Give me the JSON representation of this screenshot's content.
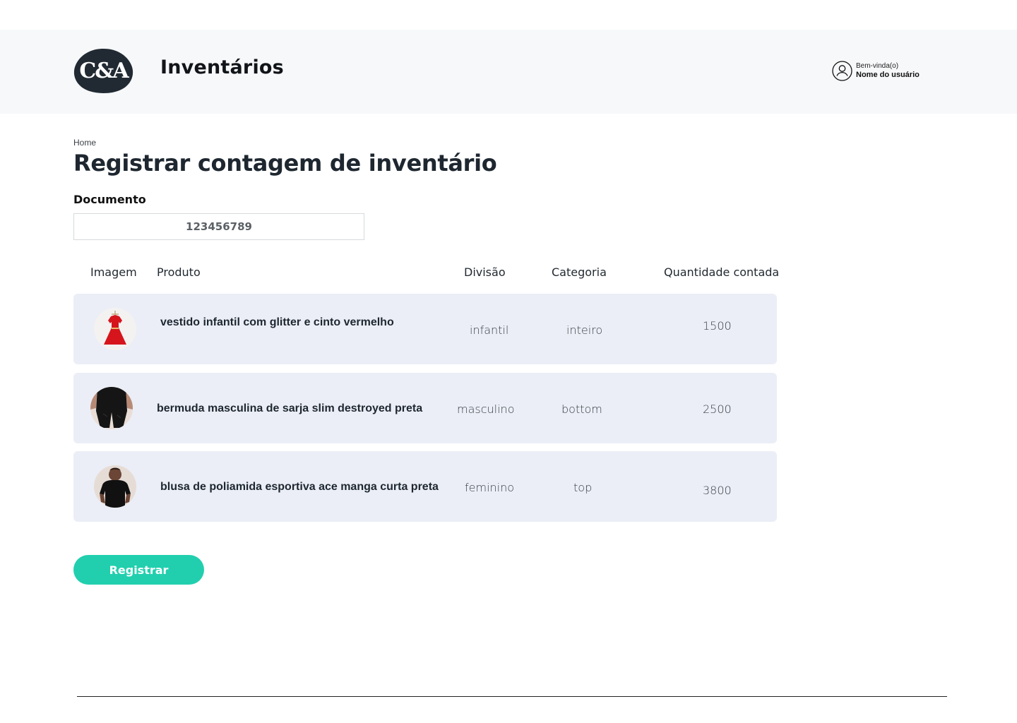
{
  "header": {
    "logo_text": "C&A",
    "app_title": "Inventários",
    "user": {
      "greeting": "Bem-vinda(o)",
      "name": "Nome do usuário",
      "icon": "user-circle-icon"
    }
  },
  "breadcrumb": "Home",
  "page_title": "Registrar contagem de inventário",
  "document": {
    "label": "Documento",
    "value": "123456789"
  },
  "table": {
    "columns": [
      "Imagem",
      "Produto",
      "Divisão",
      "Categoria",
      "Quantidade contada"
    ],
    "rows": [
      {
        "product": "vestido infantil com glitter e cinto vermelho",
        "division": "infantil",
        "category": "inteiro",
        "quantity": "1500"
      },
      {
        "product": "bermuda masculina de sarja slim destroyed preta",
        "division": "masculino",
        "category": "bottom",
        "quantity": "2500"
      },
      {
        "product": "blusa de poliamida esportiva ace manga curta preta",
        "division": "feminino",
        "category": "top",
        "quantity": "3800"
      }
    ]
  },
  "actions": {
    "register_label": "Registrar"
  },
  "colors": {
    "accent": "#21cfae",
    "logo_bg": "#212a33",
    "header_bg": "#f7f8fa",
    "row_bg": "#ebeef6"
  }
}
